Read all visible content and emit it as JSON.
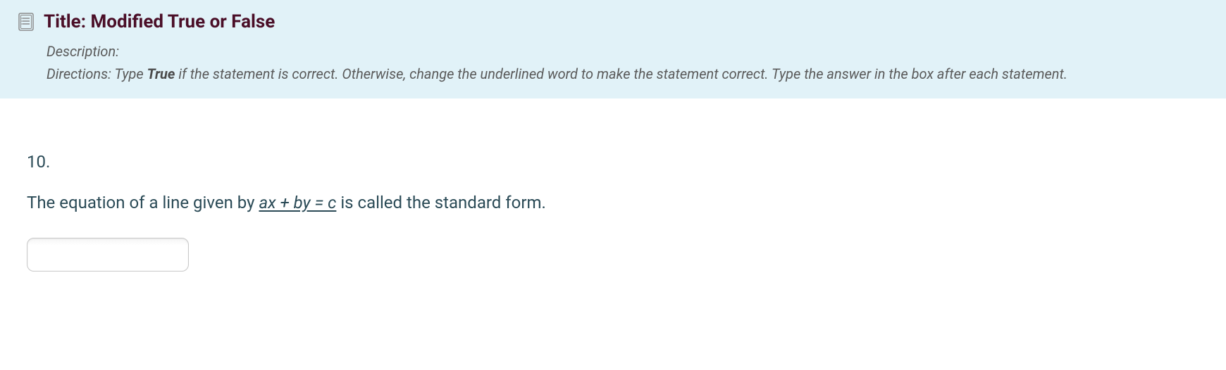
{
  "header": {
    "title_prefix": "Title: ",
    "title": "Modified True or False",
    "description_label": "Description:",
    "directions_prefix": "Directions: Type ",
    "directions_bold": "True",
    "directions_suffix": " if the statement is correct. Otherwise, change the underlined word to make the statement correct. Type the answer in the box after each statement."
  },
  "question": {
    "number": "10.",
    "text_before": "The equation of a line given by ",
    "underlined": "ax + by = c",
    "text_after": " is called the standard form."
  },
  "answer": {
    "value": "",
    "placeholder": ""
  }
}
